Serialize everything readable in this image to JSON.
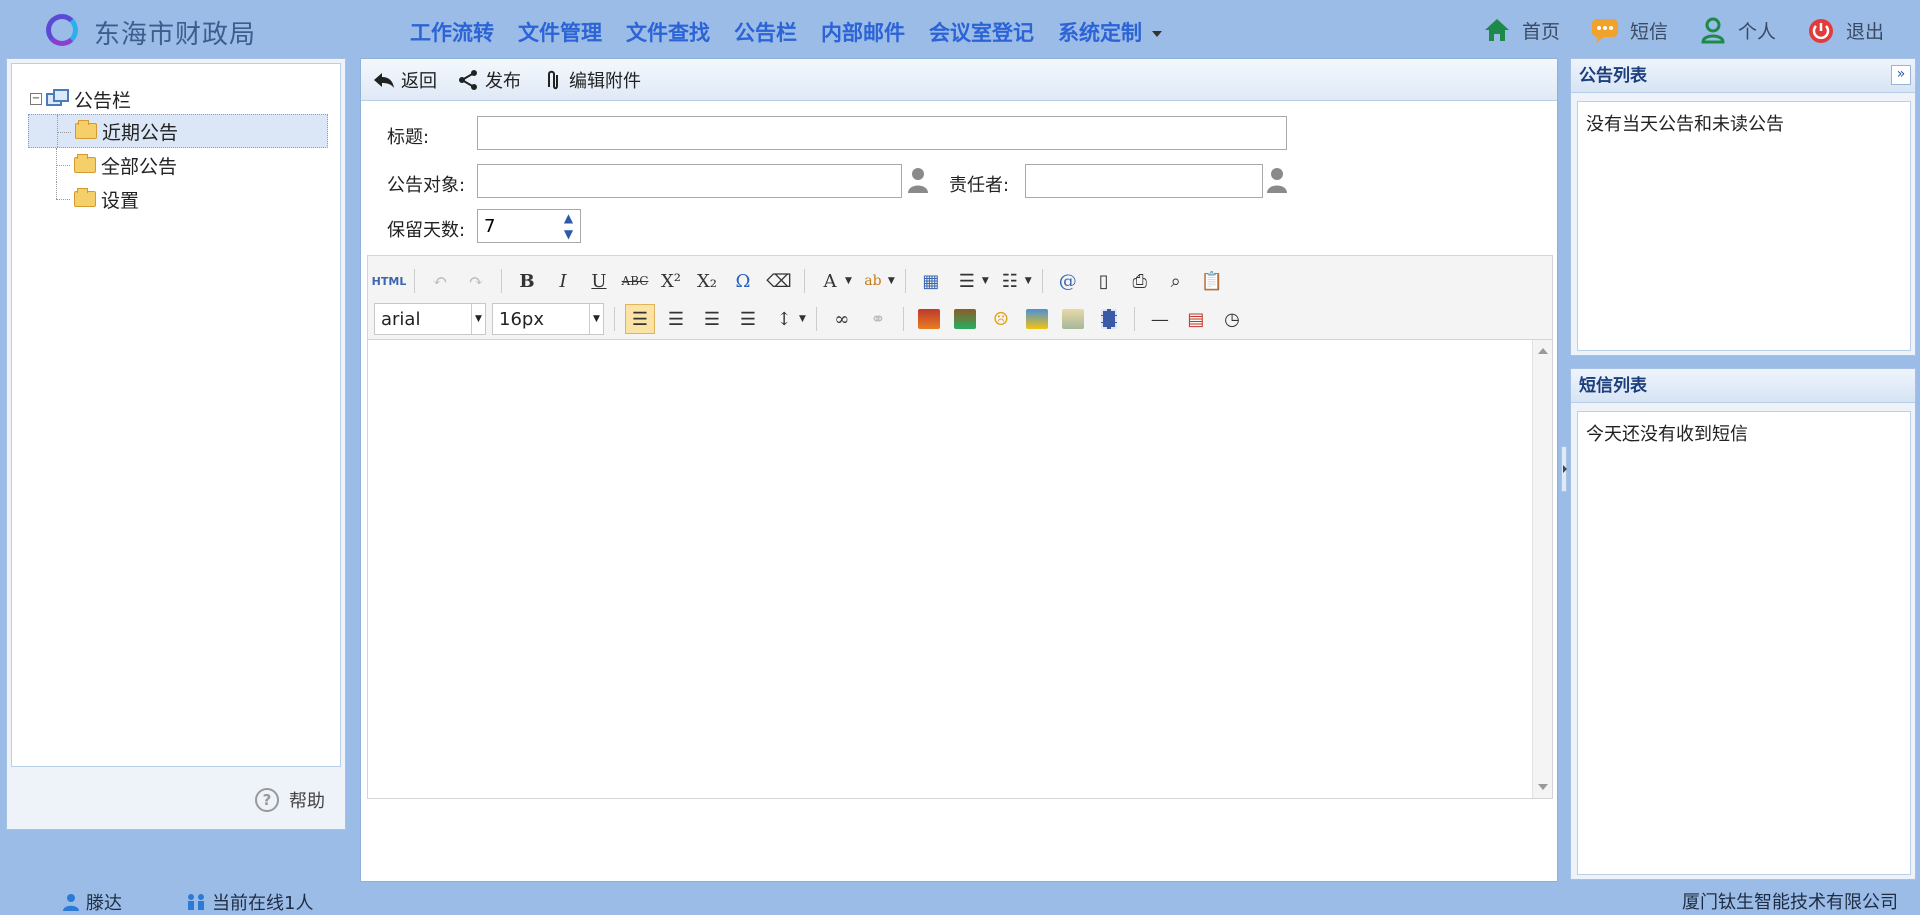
{
  "app": {
    "title": "东海市财政局"
  },
  "main_nav": [
    "工作流转",
    "文件管理",
    "文件查找",
    "公告栏",
    "内部邮件",
    "会议室登记",
    "系统定制"
  ],
  "top_links": {
    "home": "首页",
    "sms": "短信",
    "profile": "个人",
    "logout": "退出"
  },
  "sidebar": {
    "root": "公告栏",
    "items": [
      "近期公告",
      "全部公告",
      "设置"
    ],
    "selected_index": 0,
    "help": "帮助"
  },
  "toolbar": {
    "back": "返回",
    "publish": "发布",
    "attachments": "编辑附件"
  },
  "form": {
    "title_label": "标题:",
    "title_value": "",
    "target_label": "公告对象:",
    "target_value": "",
    "owner_label": "责任者:",
    "owner_value": "",
    "retain_label": "保留天数:",
    "retain_value": "7"
  },
  "editor": {
    "font_family": "arial",
    "font_size": "16px",
    "content": ""
  },
  "notice_list": {
    "title": "公告列表",
    "empty_text": "没有当天公告和未读公告"
  },
  "sms_list": {
    "title": "短信列表",
    "empty_text": "今天还没有收到短信"
  },
  "footer": {
    "user": "滕达",
    "online": "当前在线1人",
    "company": "厦门钛生智能技术有限公司"
  },
  "colors": {
    "header_bg": "#9bbce6",
    "nav_link": "#2c63d6",
    "accent": "#1c3e7c"
  }
}
